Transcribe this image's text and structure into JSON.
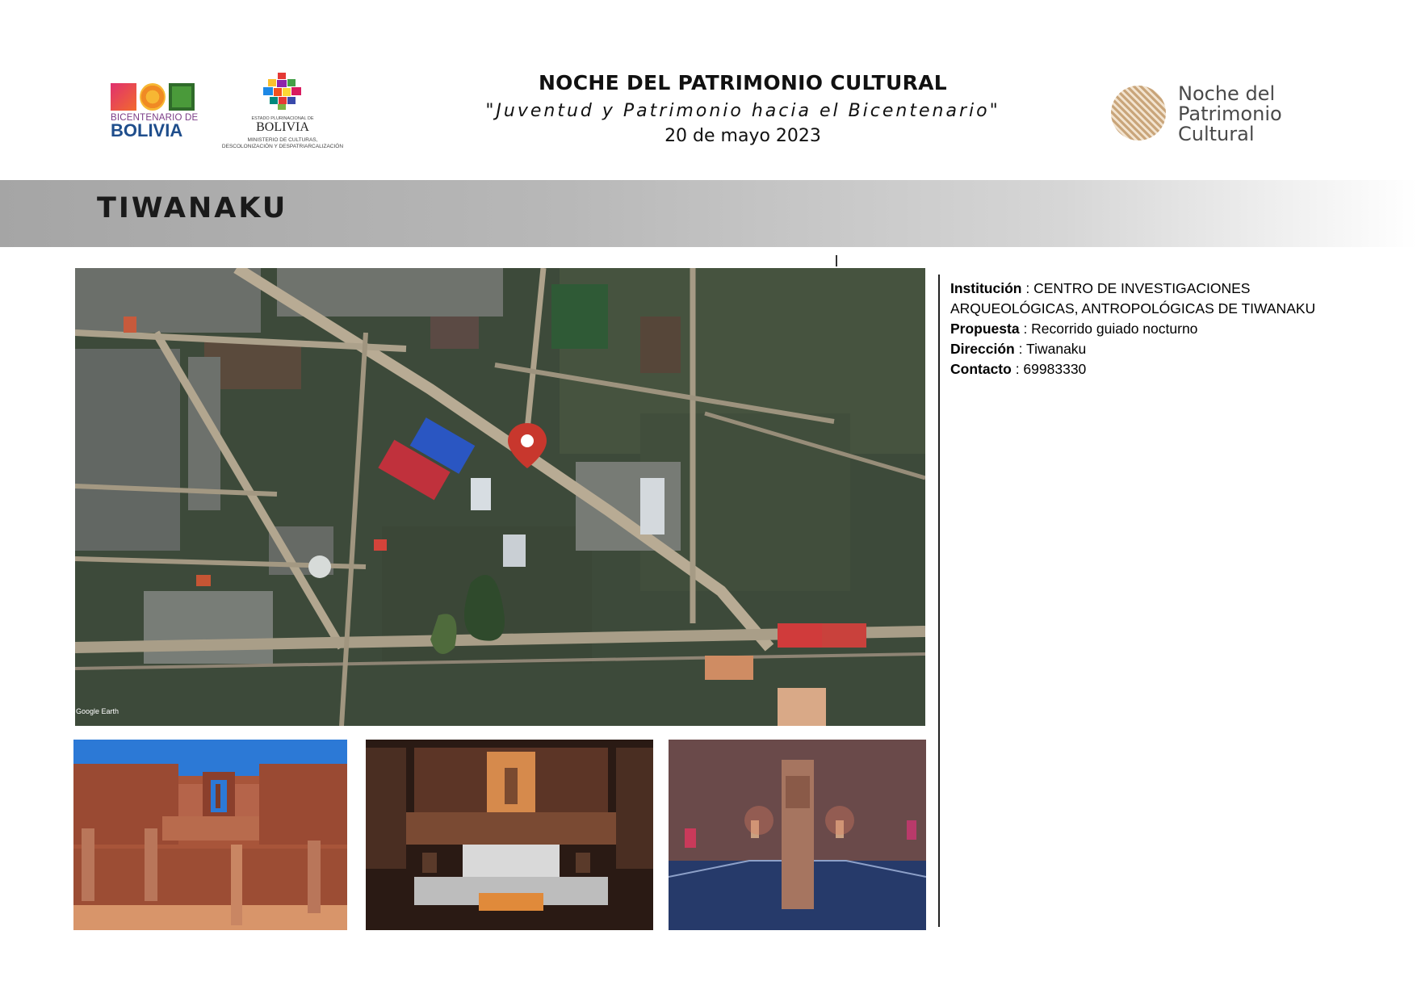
{
  "header": {
    "logo_left": {
      "line1": "BICENTENARIO DE",
      "line2": "BOLIVIA"
    },
    "logo_ministry": {
      "top": "ESTADO PLURINACIONAL DE",
      "name": "BOLIVIA",
      "sub1": "MINISTERIO DE CULTURAS,",
      "sub2": "DESCOLONIZACIÓN Y DESPATRIARCALIZACIÓN"
    },
    "title": "NOCHE DEL PATRIMONIO CULTURAL",
    "subtitle": "\"Juventud y Patrimonio hacia el Bicentenario\"",
    "date": "20 de mayo 2023",
    "logo_right": {
      "line1": "Noche del",
      "line2": "Patrimonio",
      "line3": "Cultural"
    }
  },
  "section_title": "TIWANAKU",
  "map": {
    "attribution": "Google Earth",
    "marker_color": "#c8372d"
  },
  "info": {
    "institucion_label": "Institución",
    "institucion_value1": "CENTRO DE INVESTIGACIONES",
    "institucion_value2": "ARQUEOLÓGICAS, ANTROPOLÓGICAS DE TIWANAKU",
    "propuesta_label": "Propuesta",
    "propuesta_value": "Recorrido guiado nocturno",
    "direccion_label": "Dirección",
    "direccion_value": "Tiwanaku",
    "contacto_label": "Contacto",
    "contacto_value": "69983330",
    "separator": " :  "
  },
  "colors": {
    "band_start": "#a5a5a5",
    "brand_purple": "#7a3b86",
    "brand_blue": "#1f4e8c"
  }
}
